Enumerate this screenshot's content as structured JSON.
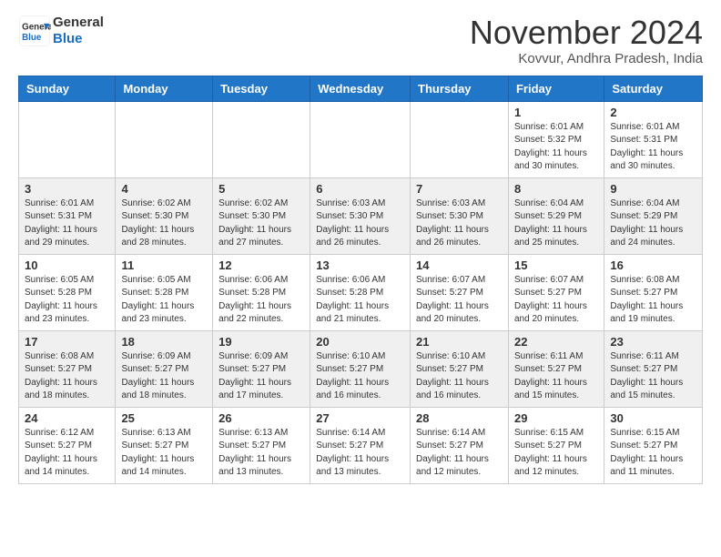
{
  "header": {
    "logo_line1": "General",
    "logo_line2": "Blue",
    "month": "November 2024",
    "location": "Kovvur, Andhra Pradesh, India"
  },
  "weekdays": [
    "Sunday",
    "Monday",
    "Tuesday",
    "Wednesday",
    "Thursday",
    "Friday",
    "Saturday"
  ],
  "weeks": [
    [
      {
        "day": "",
        "info": ""
      },
      {
        "day": "",
        "info": ""
      },
      {
        "day": "",
        "info": ""
      },
      {
        "day": "",
        "info": ""
      },
      {
        "day": "",
        "info": ""
      },
      {
        "day": "1",
        "info": "Sunrise: 6:01 AM\nSunset: 5:32 PM\nDaylight: 11 hours and 30 minutes."
      },
      {
        "day": "2",
        "info": "Sunrise: 6:01 AM\nSunset: 5:31 PM\nDaylight: 11 hours and 30 minutes."
      }
    ],
    [
      {
        "day": "3",
        "info": "Sunrise: 6:01 AM\nSunset: 5:31 PM\nDaylight: 11 hours and 29 minutes."
      },
      {
        "day": "4",
        "info": "Sunrise: 6:02 AM\nSunset: 5:30 PM\nDaylight: 11 hours and 28 minutes."
      },
      {
        "day": "5",
        "info": "Sunrise: 6:02 AM\nSunset: 5:30 PM\nDaylight: 11 hours and 27 minutes."
      },
      {
        "day": "6",
        "info": "Sunrise: 6:03 AM\nSunset: 5:30 PM\nDaylight: 11 hours and 26 minutes."
      },
      {
        "day": "7",
        "info": "Sunrise: 6:03 AM\nSunset: 5:30 PM\nDaylight: 11 hours and 26 minutes."
      },
      {
        "day": "8",
        "info": "Sunrise: 6:04 AM\nSunset: 5:29 PM\nDaylight: 11 hours and 25 minutes."
      },
      {
        "day": "9",
        "info": "Sunrise: 6:04 AM\nSunset: 5:29 PM\nDaylight: 11 hours and 24 minutes."
      }
    ],
    [
      {
        "day": "10",
        "info": "Sunrise: 6:05 AM\nSunset: 5:28 PM\nDaylight: 11 hours and 23 minutes."
      },
      {
        "day": "11",
        "info": "Sunrise: 6:05 AM\nSunset: 5:28 PM\nDaylight: 11 hours and 23 minutes."
      },
      {
        "day": "12",
        "info": "Sunrise: 6:06 AM\nSunset: 5:28 PM\nDaylight: 11 hours and 22 minutes."
      },
      {
        "day": "13",
        "info": "Sunrise: 6:06 AM\nSunset: 5:28 PM\nDaylight: 11 hours and 21 minutes."
      },
      {
        "day": "14",
        "info": "Sunrise: 6:07 AM\nSunset: 5:27 PM\nDaylight: 11 hours and 20 minutes."
      },
      {
        "day": "15",
        "info": "Sunrise: 6:07 AM\nSunset: 5:27 PM\nDaylight: 11 hours and 20 minutes."
      },
      {
        "day": "16",
        "info": "Sunrise: 6:08 AM\nSunset: 5:27 PM\nDaylight: 11 hours and 19 minutes."
      }
    ],
    [
      {
        "day": "17",
        "info": "Sunrise: 6:08 AM\nSunset: 5:27 PM\nDaylight: 11 hours and 18 minutes."
      },
      {
        "day": "18",
        "info": "Sunrise: 6:09 AM\nSunset: 5:27 PM\nDaylight: 11 hours and 18 minutes."
      },
      {
        "day": "19",
        "info": "Sunrise: 6:09 AM\nSunset: 5:27 PM\nDaylight: 11 hours and 17 minutes."
      },
      {
        "day": "20",
        "info": "Sunrise: 6:10 AM\nSunset: 5:27 PM\nDaylight: 11 hours and 16 minutes."
      },
      {
        "day": "21",
        "info": "Sunrise: 6:10 AM\nSunset: 5:27 PM\nDaylight: 11 hours and 16 minutes."
      },
      {
        "day": "22",
        "info": "Sunrise: 6:11 AM\nSunset: 5:27 PM\nDaylight: 11 hours and 15 minutes."
      },
      {
        "day": "23",
        "info": "Sunrise: 6:11 AM\nSunset: 5:27 PM\nDaylight: 11 hours and 15 minutes."
      }
    ],
    [
      {
        "day": "24",
        "info": "Sunrise: 6:12 AM\nSunset: 5:27 PM\nDaylight: 11 hours and 14 minutes."
      },
      {
        "day": "25",
        "info": "Sunrise: 6:13 AM\nSunset: 5:27 PM\nDaylight: 11 hours and 14 minutes."
      },
      {
        "day": "26",
        "info": "Sunrise: 6:13 AM\nSunset: 5:27 PM\nDaylight: 11 hours and 13 minutes."
      },
      {
        "day": "27",
        "info": "Sunrise: 6:14 AM\nSunset: 5:27 PM\nDaylight: 11 hours and 13 minutes."
      },
      {
        "day": "28",
        "info": "Sunrise: 6:14 AM\nSunset: 5:27 PM\nDaylight: 11 hours and 12 minutes."
      },
      {
        "day": "29",
        "info": "Sunrise: 6:15 AM\nSunset: 5:27 PM\nDaylight: 11 hours and 12 minutes."
      },
      {
        "day": "30",
        "info": "Sunrise: 6:15 AM\nSunset: 5:27 PM\nDaylight: 11 hours and 11 minutes."
      }
    ]
  ]
}
